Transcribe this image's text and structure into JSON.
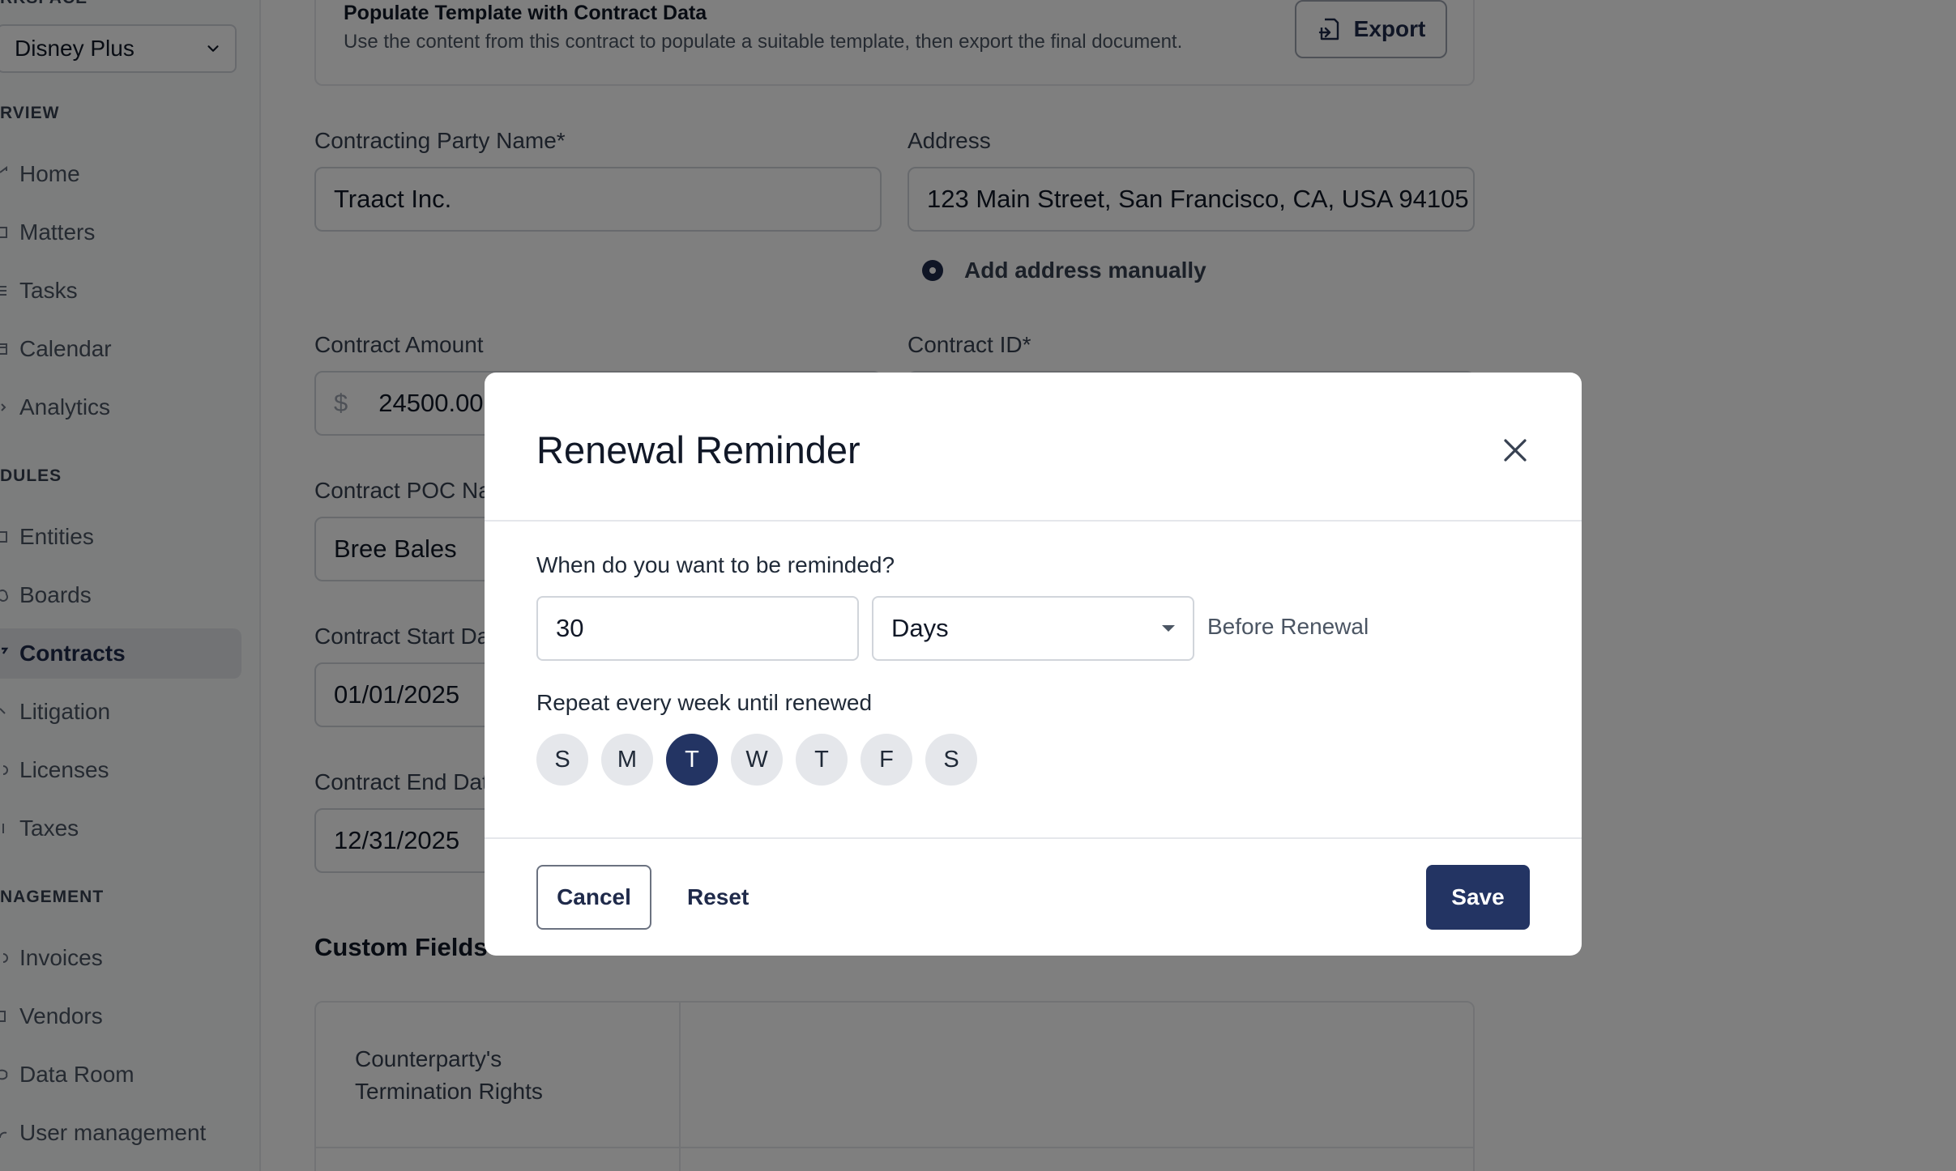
{
  "sidebar": {
    "workspace_label": "RKSPACE",
    "workspace_value": "Disney Plus",
    "sections": {
      "overview": "RVIEW",
      "modules": "DULES",
      "management": "NAGEMENT"
    },
    "overview_items": [
      "Home",
      "Matters",
      "Tasks",
      "Calendar",
      "Analytics"
    ],
    "module_items": [
      "Entities",
      "Boards",
      "Contracts",
      "Litigation",
      "Licenses",
      "Taxes"
    ],
    "management_items": [
      "Invoices",
      "Vendors",
      "Data Room",
      "User management"
    ],
    "active_item": "Contracts"
  },
  "main": {
    "template_card": {
      "title": "Populate Template with Contract Data",
      "description": "Use the content from this contract to populate a suitable template, then export the final document.",
      "export_label": "Export"
    },
    "fields": {
      "party_name_label": "Contracting Party Name*",
      "party_name_value": "Traact Inc.",
      "address_label": "Address",
      "address_value": "123 Main Street, San Francisco, CA, USA 94105",
      "add_address_label": "Add address manually",
      "amount_label": "Contract Amount",
      "amount_currency": "$",
      "amount_value": "24500.00",
      "contract_id_label": "Contract ID*",
      "poc_label": "Contract POC Name",
      "poc_value": "Bree Bales",
      "start_label": "Contract Start Date",
      "start_value": "01/01/2025",
      "end_label": "Contract End Date",
      "end_value": "12/31/2025"
    },
    "custom_fields": {
      "title": "Custom Fields",
      "row1_label_line1": "Counterparty's",
      "row1_label_line2": "Termination Rights"
    }
  },
  "modal": {
    "title": "Renewal Reminder",
    "question": "When do you want to be reminded?",
    "amount_value": "30",
    "unit_value": "Days",
    "before_text": "Before Renewal",
    "repeat_text": "Repeat every week until renewed",
    "days": [
      "S",
      "M",
      "T",
      "W",
      "T",
      "F",
      "S"
    ],
    "selected_day_index": 2,
    "cancel_label": "Cancel",
    "reset_label": "Reset",
    "save_label": "Save",
    "accent_color": "#233463"
  }
}
